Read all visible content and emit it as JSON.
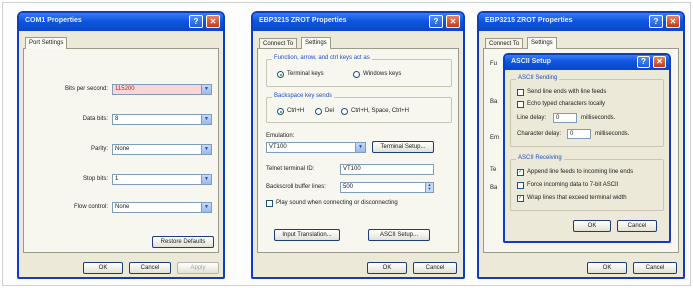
{
  "dialog1": {
    "title": "COM1 Properties",
    "tab": "Port Settings",
    "fields": [
      {
        "label": "Bits per second:",
        "value": "115200"
      },
      {
        "label": "Data bits:",
        "value": "8"
      },
      {
        "label": "Parity:",
        "value": "None"
      },
      {
        "label": "Stop bits:",
        "value": "1"
      },
      {
        "label": "Flow control:",
        "value": "None"
      }
    ],
    "restore_label": "Restore Defaults",
    "ok_label": "OK",
    "cancel_label": "Cancel",
    "apply_label": "Apply"
  },
  "dialog2": {
    "title": "EBP3215 ZROT Properties",
    "tabs": [
      "Connect To",
      "Settings"
    ],
    "function_group": "Function, arrow, and ctrl keys act as",
    "terminal_keys": "Terminal keys",
    "windows_keys": "Windows keys",
    "backspace_group": "Backspace key sends",
    "bs_opt1": "Ctrl+H",
    "bs_opt2": "Del",
    "bs_opt3": "Ctrl+H, Space, Ctrl+H",
    "emulation_label": "Emulation:",
    "emulation_value": "VT100",
    "terminal_setup_label": "Terminal Setup...",
    "telnet_label": "Telnet terminal ID:",
    "telnet_value": "VT100",
    "backscroll_label": "Backscroll buffer lines:",
    "backscroll_value": "500",
    "play_sound_label": "Play sound when connecting or disconnecting",
    "input_translation_label": "Input Translation...",
    "ascii_setup_label": "ASCII Setup...",
    "ok_label": "OK",
    "cancel_label": "Cancel"
  },
  "dialog3": {
    "title": "EBP3215 ZROT Properties",
    "tabs": [
      "Connect To",
      "Settings"
    ],
    "side_letters": [
      "Fu",
      "Ba",
      "Em",
      "Te",
      "Ba"
    ],
    "ok_label": "OK",
    "cancel_label": "Cancel"
  },
  "ascii": {
    "title": "ASCII Setup",
    "sending_group": "ASCII Sending",
    "send_line_ends": "Send line ends with line feeds",
    "echo_typed": "Echo typed characters locally",
    "line_delay_label": "Line delay:",
    "line_delay_value": "0",
    "line_delay_unit": "milliseconds.",
    "char_delay_label": "Character delay:",
    "char_delay_value": "0",
    "char_delay_unit": "milliseconds.",
    "receiving_group": "ASCII Receiving",
    "append_lf": "Append line feeds to incoming line ends",
    "force_7bit": "Force incoming data to 7-bit ASCII",
    "wrap_lines": "Wrap lines that exceed terminal width",
    "checks": {
      "send_line_ends": false,
      "echo_typed": false,
      "append_lf": true,
      "force_7bit": false,
      "wrap_lines": true
    },
    "ok_label": "OK",
    "cancel_label": "Cancel"
  },
  "colors": {
    "titlebar": "#0d56e0",
    "dialog_bg": "#ece9d8",
    "close_button": "#c4391c",
    "highlight_field": "#fbd6d6"
  }
}
